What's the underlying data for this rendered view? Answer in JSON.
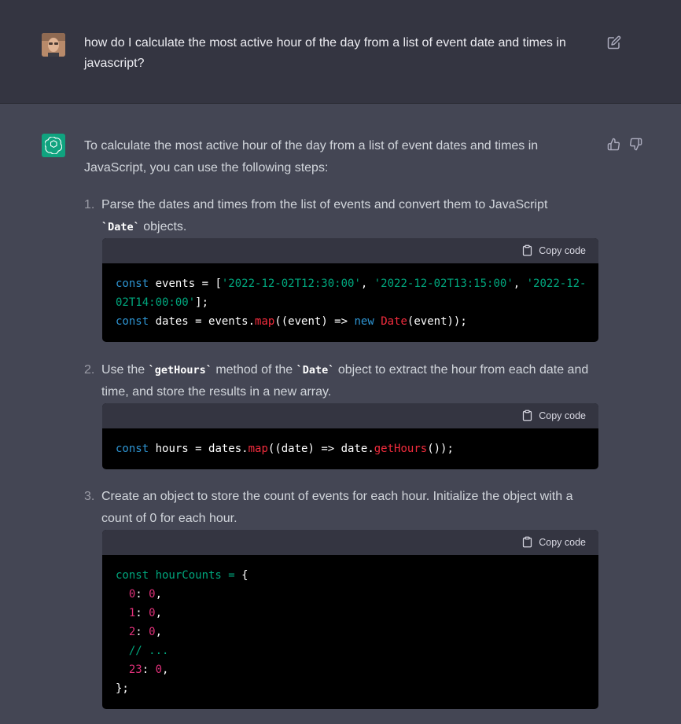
{
  "user": {
    "message": "how do  I calculate the most active hour of the day from a list of event date and times in javascript?"
  },
  "assistant": {
    "intro": "To calculate the most active hour of the day from a list of event dates and times in JavaScript, you can use the following steps:",
    "steps": [
      {
        "num": "1.",
        "parts": [
          "Parse the dates and times from the list of events and convert them to JavaScript ",
          "`Date`",
          " objects."
        ],
        "copy_label": "Copy code",
        "code": [
          "const events = ['2022-12-02T12:30:00', '2022-12-02T13:15:00', '2022-12-",
          "02T14:00:00'];",
          "const dates = events.map((event) => new Date(event));"
        ]
      },
      {
        "num": "2.",
        "parts": [
          "Use the ",
          "`getHours`",
          " method of the ",
          "`Date`",
          " object to extract the hour from each date and time, and store the results in a new array."
        ],
        "copy_label": "Copy code",
        "code": [
          "const hours = dates.map((date) => date.getHours());"
        ]
      },
      {
        "num": "3.",
        "parts": [
          "Create an object to store the count of events for each hour. Initialize the object with a count of 0 for each hour."
        ],
        "copy_label": "Copy code",
        "code": [
          "const hourCounts = {",
          "  0: 0,",
          "  1: 0,",
          "  2: 0,",
          "  // ...",
          "  23: 0,",
          "};"
        ]
      }
    ]
  },
  "icons": {
    "edit": "edit-icon",
    "thumbs_up": "thumbs-up-icon",
    "thumbs_down": "thumbs-down-icon",
    "copy": "clipboard-icon",
    "logo": "openai-logo"
  },
  "colors": {
    "user_bg": "#343541",
    "assistant_bg": "#444654",
    "brand": "#10a37f",
    "code_keyword": "#2e95d3",
    "code_string": "#00a67d",
    "code_function": "#f22c3d",
    "code_number": "#df3079"
  }
}
